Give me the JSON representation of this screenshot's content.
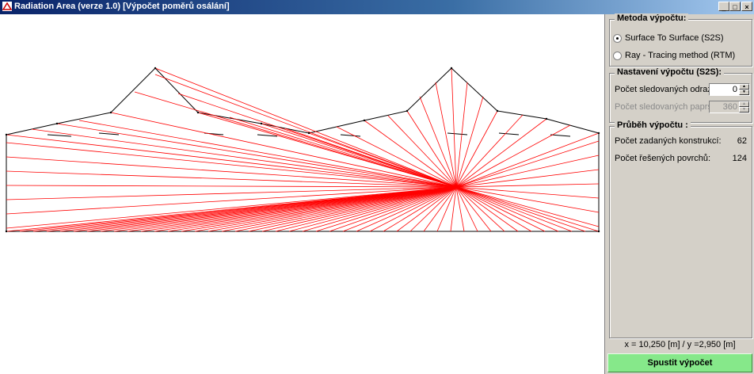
{
  "window": {
    "title": "Radiation Area (verze 1.0) [Výpočet poměrů osálání]",
    "controls": {
      "minimize": "_",
      "maximize": "□",
      "close": "×"
    }
  },
  "method_group": {
    "title": "Metoda výpočtu:",
    "options": [
      {
        "label": "Surface To Surface (S2S)",
        "selected": true
      },
      {
        "label": "Ray - Tracing method (RTM)",
        "selected": false
      }
    ]
  },
  "settings_group": {
    "title": "Nastavení výpočtu (S2S):",
    "reflections_label": "Počet sledovaných odrazů:",
    "reflections_value": "0",
    "rays_label": "Počet sledovaných paprsků:",
    "rays_value": "360"
  },
  "progress_group": {
    "title": "Průběh výpočtu :",
    "constructions_label": "Počet zadaných konstrukcí:",
    "constructions_value": "62",
    "surfaces_label": "Počet řešených povrchů:",
    "surfaces_value": "124"
  },
  "status": {
    "coordinates": "x = 10,250 [m]  / y =2,950 [m]"
  },
  "run_button": {
    "label": "Spustit výpočet"
  },
  "colors": {
    "ray": "#ff0000",
    "outline": "#000000",
    "run_button": "#86e88a"
  }
}
